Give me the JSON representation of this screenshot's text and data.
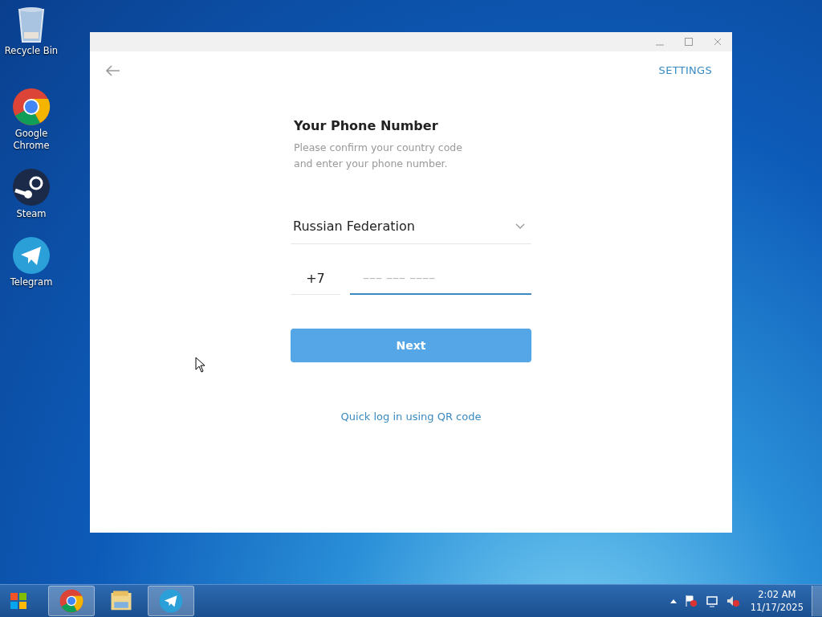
{
  "desktop_icons": [
    {
      "kind": "recycle",
      "label": "Recycle Bin"
    },
    {
      "kind": "chrome",
      "label": "Google Chrome"
    },
    {
      "kind": "steam",
      "label": "Steam"
    },
    {
      "kind": "telegram",
      "label": "Telegram"
    }
  ],
  "window": {
    "settings_link": "SETTINGS",
    "title": "Your Phone Number",
    "subtitle": "Please confirm your country code and enter your phone number.",
    "country": "Russian Federation",
    "country_code": "+7",
    "phone_placeholder": "––– ––– ––––",
    "next_button": "Next",
    "qr_link": "Quick log in using QR code"
  },
  "taskbar": {
    "apps": [
      {
        "kind": "chrome",
        "running": true
      },
      {
        "kind": "folder",
        "running": false
      },
      {
        "kind": "telegram",
        "running": true
      }
    ],
    "time": "2:02 AM",
    "date": "11/17/2025"
  }
}
